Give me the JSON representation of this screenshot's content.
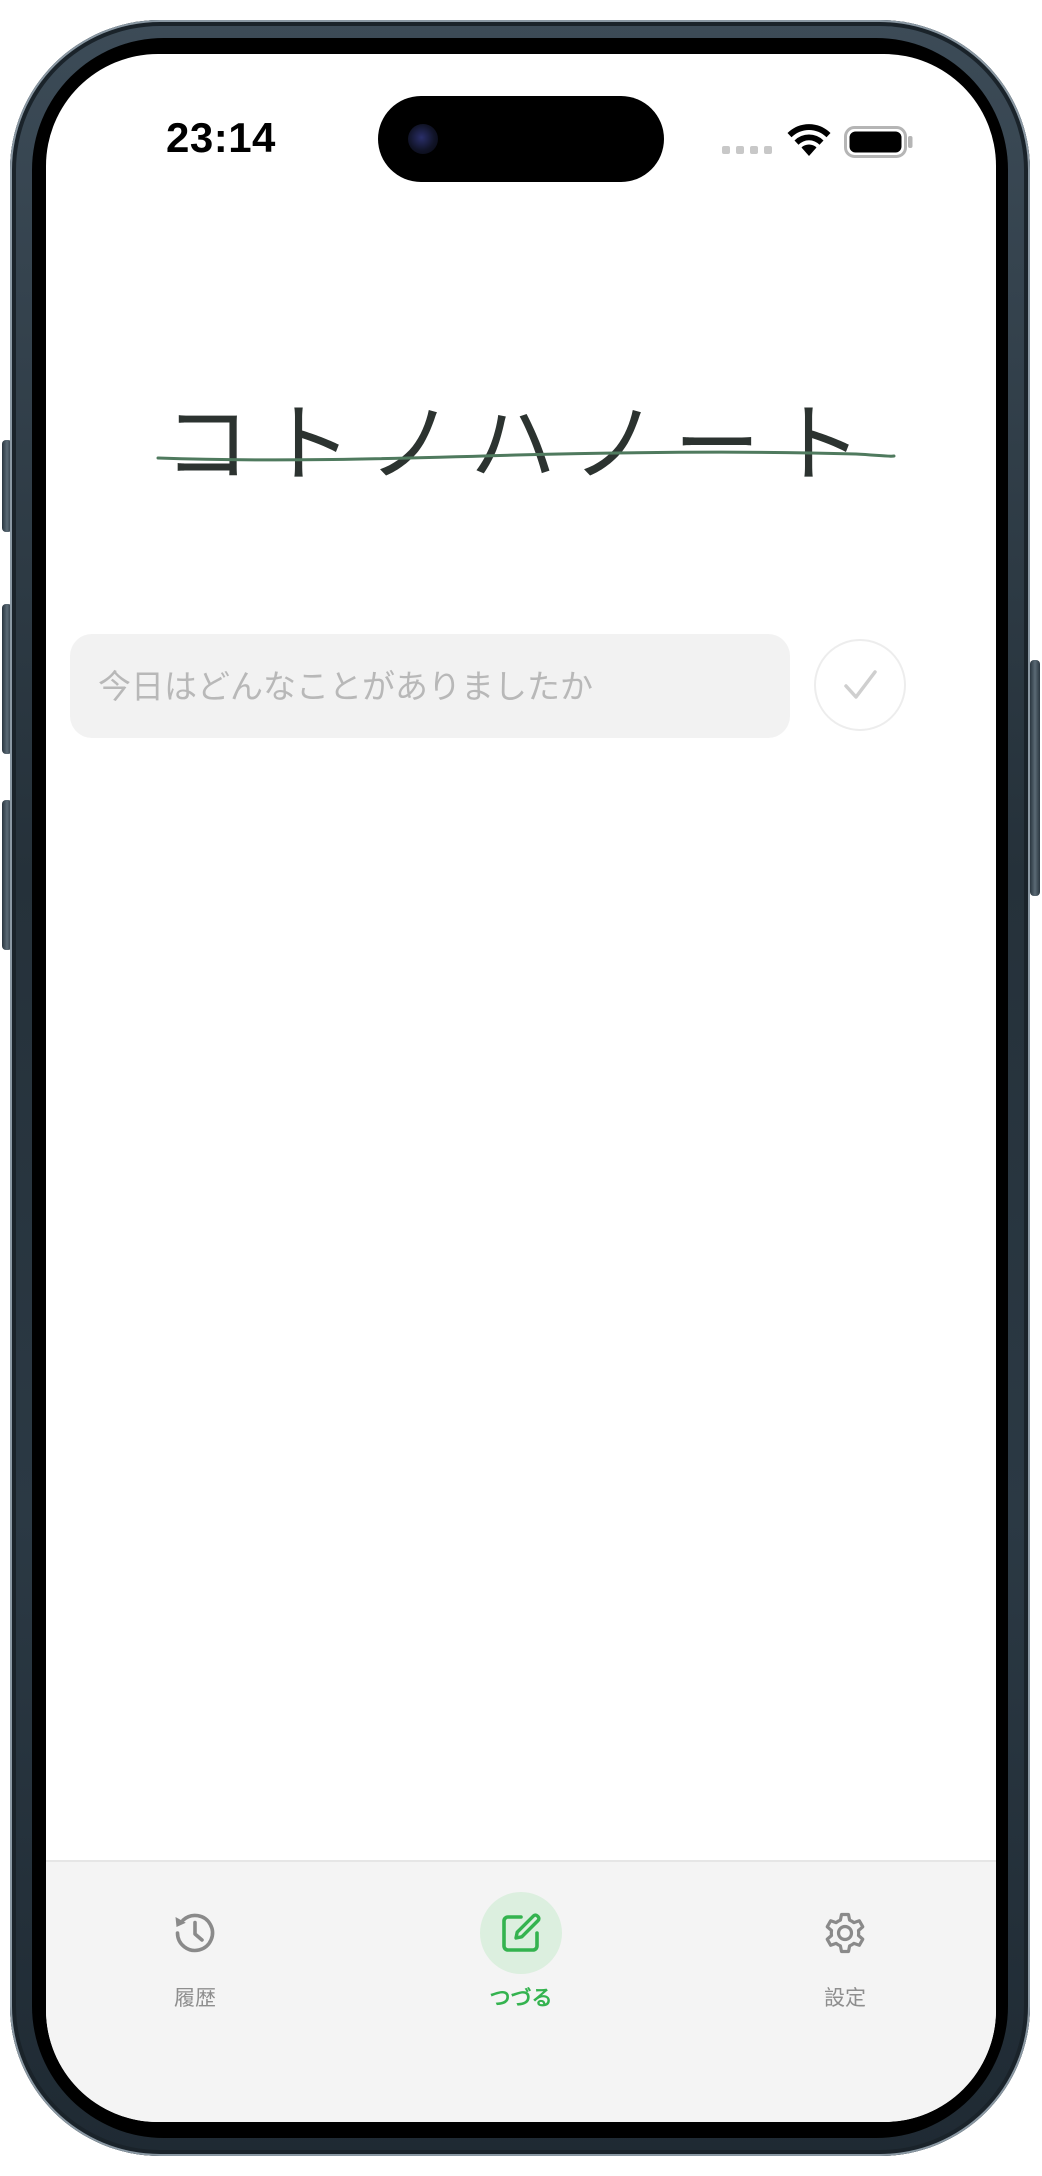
{
  "status_bar": {
    "time": "23:14"
  },
  "app": {
    "title": "コトノハノート"
  },
  "entry": {
    "placeholder": "今日はどんなことがありましたか",
    "value": ""
  },
  "tabs": [
    {
      "label": "履歴",
      "icon": "history-icon",
      "active": false
    },
    {
      "label": "つづる",
      "icon": "compose-icon",
      "active": true
    },
    {
      "label": "設定",
      "icon": "gear-icon",
      "active": false
    }
  ],
  "colors": {
    "accent": "#34b34f",
    "accent_soft": "#dcefdf",
    "title_ink": "#2c3330",
    "underline": "#4f7a5e",
    "input_bg": "#f2f2f2",
    "placeholder": "#b8b8b8",
    "tab_bar_bg": "#f4f4f4",
    "inactive": "#8e8e8e"
  }
}
